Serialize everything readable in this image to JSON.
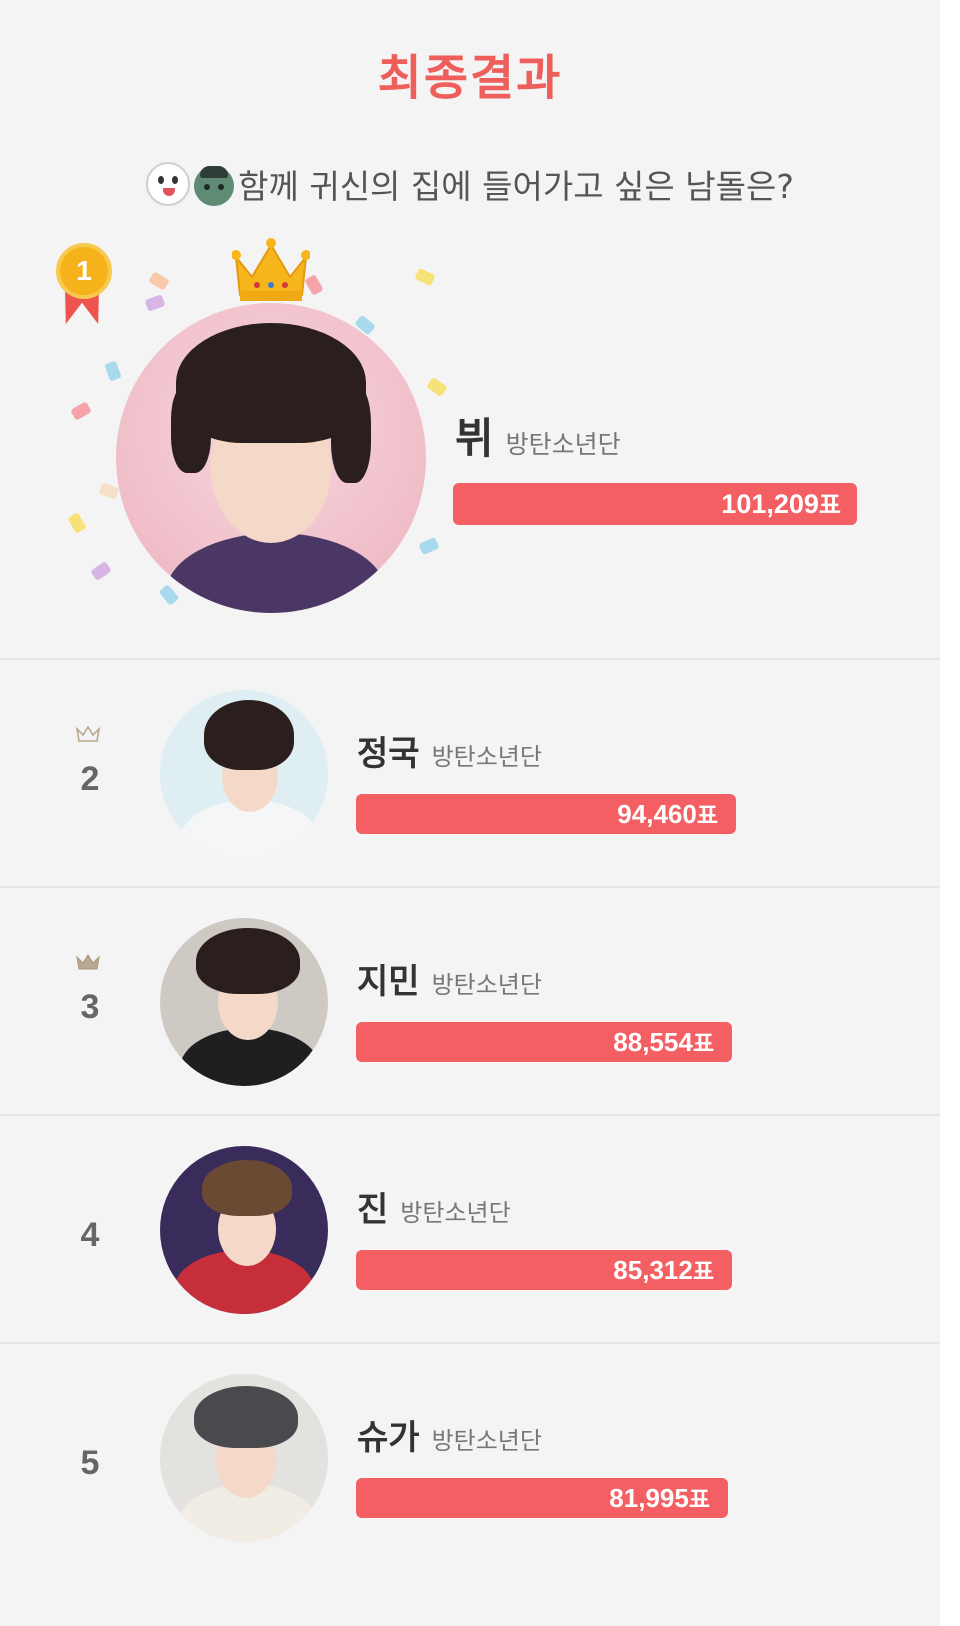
{
  "header": {
    "title": "최종결과",
    "question": "함께 귀신의 집에 들어가고 싶은 남돌은?",
    "emoji": [
      "ghost-icon",
      "zombie-icon"
    ]
  },
  "unit": "표",
  "colors": {
    "accent": "#ee5f5c",
    "bar": "#f35f62",
    "text": "#333333",
    "muted": "#777777"
  },
  "results": [
    {
      "rank": "1",
      "name": "뷔",
      "group": "방탄소년단",
      "votes": "101,209",
      "vote_count": 101209
    },
    {
      "rank": "2",
      "name": "정국",
      "group": "방탄소년단",
      "votes": "94,460",
      "vote_count": 94460
    },
    {
      "rank": "3",
      "name": "지민",
      "group": "방탄소년단",
      "votes": "88,554",
      "vote_count": 88554
    },
    {
      "rank": "4",
      "name": "진",
      "group": "방탄소년단",
      "votes": "85,312",
      "vote_count": 85312
    },
    {
      "rank": "5",
      "name": "슈가",
      "group": "방탄소년단",
      "votes": "81,995",
      "vote_count": 81995
    }
  ]
}
